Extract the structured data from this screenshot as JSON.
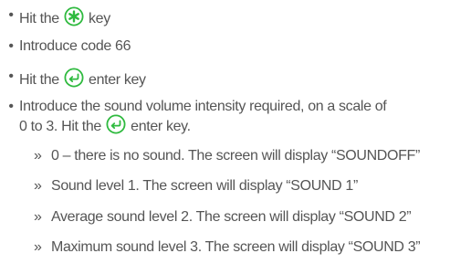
{
  "colors": {
    "text": "#555555",
    "icon_green": "#2fba3f"
  },
  "icons": {
    "star_key": "asterisk-circle-icon",
    "enter_key": "enter-arrow-circle-icon"
  },
  "steps": [
    {
      "before": "Hit the",
      "after": "key"
    },
    {
      "text": "Introduce code 66"
    },
    {
      "before": "Hit the",
      "after": "enter key"
    },
    {
      "line1": "Introduce the sound volume intensity required, on a scale of",
      "line2_before": "0 to 3. Hit the",
      "line2_after": "enter key."
    }
  ],
  "sub_marker": "»",
  "options": [
    "0 – there is no sound. The screen will display “SOUNDOFF”",
    "Sound level 1. The screen will display “SOUND 1”",
    "Average sound level 2. The screen will display “SOUND 2”",
    "Maximum sound level 3. The screen will display “SOUND 3”"
  ]
}
